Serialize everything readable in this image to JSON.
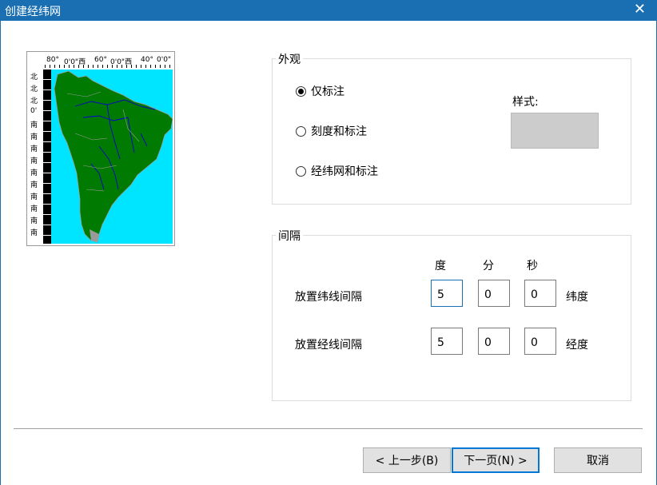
{
  "window": {
    "title": "创建经纬网",
    "close_glyph": "✕"
  },
  "preview": {
    "top_labels": [
      "80°",
      "0'0\"西",
      "60°",
      "0'0\"西",
      "40°",
      "0'0\""
    ],
    "left_labels": [
      "北",
      "北",
      "北",
      "0'",
      "南",
      "南",
      "南",
      "南",
      "南",
      "南",
      "南",
      "南",
      "南",
      "南"
    ],
    "colors": {
      "ocean": "#00e5ff",
      "land": "#007a00",
      "rivers": "#0000cc",
      "borders": "#9a9a9a"
    }
  },
  "appearance": {
    "legend": "外观",
    "options": [
      {
        "label": "仅标注",
        "selected": true
      },
      {
        "label": "刻度和标注",
        "selected": false
      },
      {
        "label": "经纬网和标注",
        "selected": false
      }
    ],
    "style_label": "样式:",
    "style_color": "#cccccc"
  },
  "interval": {
    "legend": "间隔",
    "col_headers": {
      "deg": "度",
      "min": "分",
      "sec": "秒"
    },
    "rows": [
      {
        "label": "放置纬线间隔",
        "deg": "5",
        "min": "0",
        "sec": "0",
        "unit": "纬度"
      },
      {
        "label": "放置经线间隔",
        "deg": "5",
        "min": "0",
        "sec": "0",
        "unit": "经度"
      }
    ]
  },
  "buttons": {
    "back": "< 上一步(B)",
    "next": "下一页(N) >",
    "cancel": "取消"
  }
}
